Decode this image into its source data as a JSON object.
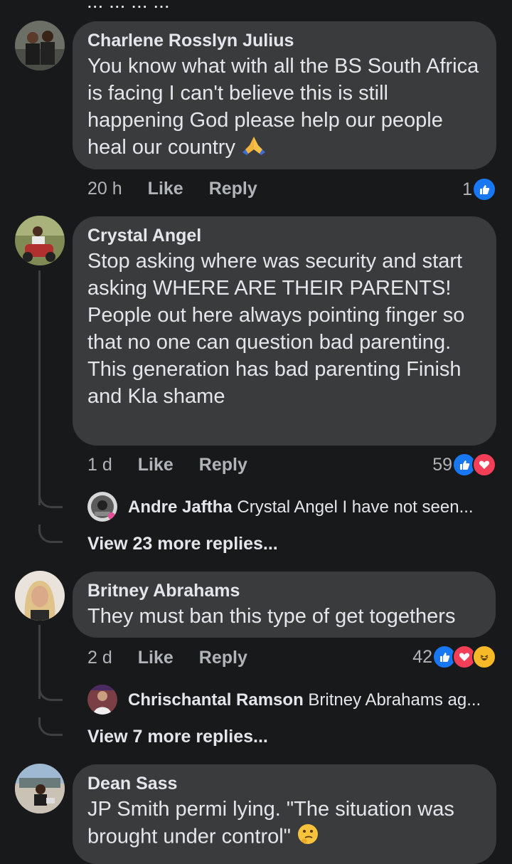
{
  "top_clipped_text": "... ... ... ...",
  "comments": [
    {
      "name": "Charlene Rosslyn Julius",
      "text": "You know what with all the BS South Africa is facing I can't believe this is still happening God please help our people heal our country",
      "time": "20 h",
      "like_label": "Like",
      "reply_label": "Reply",
      "reaction_count": "1",
      "reactions": [
        "like"
      ]
    },
    {
      "name": "Crystal Angel",
      "text_lines": [
        "Stop asking where was security and start asking WHERE ARE THEIR PARENTS!",
        "People out here always pointing finger so that no one can question bad parenting. This generation has bad parenting Finish and Kla shame"
      ],
      "time": "1 d",
      "like_label": "Like",
      "reply_label": "Reply",
      "reaction_count": "59",
      "reactions": [
        "like",
        "love"
      ],
      "reply_preview": {
        "name": "Andre Jaftha",
        "text": "Crystal Angel I have not seen..."
      },
      "view_more": "View 23 more replies..."
    },
    {
      "name": "Britney Abrahams",
      "text": "They must ban this type of get togethers",
      "time": "2 d",
      "like_label": "Like",
      "reply_label": "Reply",
      "reaction_count": "42",
      "reactions": [
        "like",
        "love",
        "haha"
      ],
      "reply_preview": {
        "name": "Chrischantal Ramson",
        "text": "Britney Abrahams ag..."
      },
      "view_more": "View 7 more replies..."
    },
    {
      "name": "Dean Sass",
      "text": "JP Smith permi lying. \"The situation was brought under control\""
    }
  ],
  "colors": {
    "background": "#18191a",
    "bubble": "#3a3b3c",
    "secondary_text": "#b0b3b8",
    "like_blue": "#1877f2",
    "love_red": "#f33e58"
  }
}
